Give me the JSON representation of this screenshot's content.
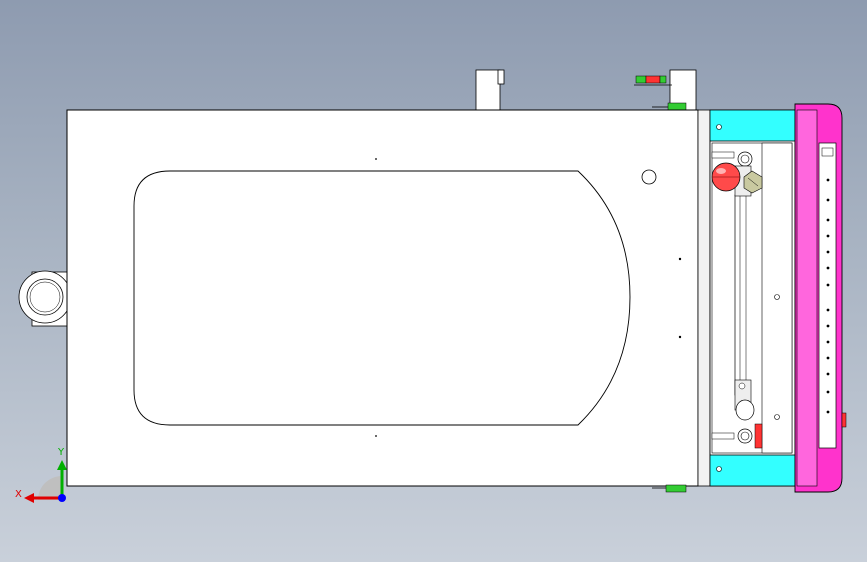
{
  "viewport": {
    "background_top": "#8e9bb0",
    "background_bottom": "#c9d0da"
  },
  "model": {
    "body_color": "#ffffff",
    "edge_color": "#000000",
    "accent_cyan": "#33ffff",
    "accent_magenta": "#ff33cc",
    "accent_green": "#33cc33",
    "accent_red": "#ff3333"
  },
  "triad": {
    "x_label": "X",
    "y_label": "Y",
    "x_color": "#e00000",
    "y_color": "#00b000",
    "z_color": "#0000ff"
  }
}
